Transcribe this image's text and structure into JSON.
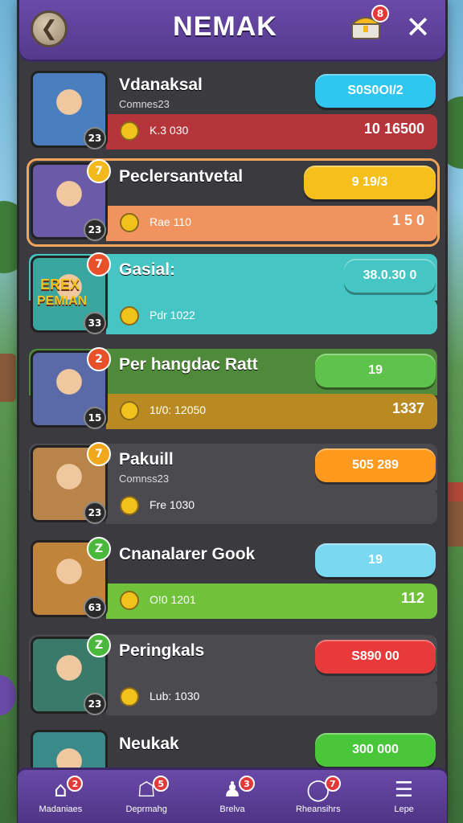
{
  "header": {
    "title": "NEMAK",
    "back_icon": "chevron-left-icon",
    "chest_badge": "8",
    "close_icon": "close-icon"
  },
  "rows": [
    {
      "name": "Vdanaksal",
      "subtitle": "Comnes23",
      "level": "23",
      "rank": "",
      "button": "S0S0OI/2",
      "button_color": "#2fc6f0",
      "bottom_label": "K.3 030",
      "bottom_value": "10 16500",
      "bottom_color": "#b5353a",
      "top_color": "#3a3a3f"
    },
    {
      "name": "Peclersantvetal",
      "subtitle": "",
      "level": "23",
      "rank": "7",
      "button": "9 19/3",
      "button_color": "#f5c01c",
      "bottom_label": "Rae 110",
      "bottom_value": "1 5 0",
      "bottom_color": "#f0935f",
      "top_color": "#3a3a3f"
    },
    {
      "name": "Gasial:",
      "subtitle": "",
      "level": "33",
      "rank": "7",
      "button": "38.0.30 0",
      "button_color": "#45c6c4",
      "bottom_label": "Pdr 1022",
      "bottom_value": "",
      "bottom_color": "#45c6c4",
      "top_color": "#45c6c4",
      "avatar_text_1": "EREX",
      "avatar_text_2": "PEMIAN"
    },
    {
      "name": "Per hangdac Ratt",
      "subtitle": "",
      "level": "15",
      "rank": "2",
      "button": "19",
      "button_color": "#5fc24a",
      "bottom_label": "1t/0: 12050",
      "bottom_value": "1337",
      "bottom_color": "#b98a22",
      "top_color": "#4e8a3a"
    },
    {
      "name": "Pakuill",
      "subtitle": "Comnss23",
      "level": "23",
      "rank": "7",
      "button": "505 289",
      "button_color": "#ff9a1e",
      "bottom_label": "Fre 1030",
      "bottom_value": "",
      "bottom_color": "#4a4a4f",
      "top_color": "#4a4a4f"
    },
    {
      "name": "Cnanalarer Gook",
      "subtitle": "",
      "level": "63",
      "rank": "Z",
      "button": "19",
      "button_color": "#7ad8f0",
      "bottom_label": "O!0 1201",
      "bottom_value": "112",
      "bottom_color": "#6fc23a",
      "top_color": "#3a3a3f"
    },
    {
      "name": "Peringkals",
      "subtitle": "",
      "level": "23",
      "rank": "Z",
      "button": "S890 00",
      "button_color": "#e83a3a",
      "bottom_label": "Lub: 1030",
      "bottom_value": "",
      "bottom_color": "#4a4a4f",
      "top_color": "#4a4a4f"
    },
    {
      "name": "Neukak",
      "subtitle": "",
      "level": "",
      "rank": "",
      "button": "300 000",
      "button_color": "#4ac63a",
      "bottom_label": "",
      "bottom_value": "",
      "bottom_color": "#3a3a3f",
      "top_color": "#3a3a3f"
    }
  ],
  "nav": [
    {
      "label": "Madaniaes",
      "icon": "home-icon",
      "badge": "2"
    },
    {
      "label": "Deprmahg",
      "icon": "shop-icon",
      "badge": "5"
    },
    {
      "label": "Brelva",
      "icon": "friends-icon",
      "badge": "3"
    },
    {
      "label": "Rheansihrs",
      "icon": "events-icon",
      "badge": "7"
    },
    {
      "label": "Lepe",
      "icon": "menu-icon",
      "badge": ""
    }
  ]
}
